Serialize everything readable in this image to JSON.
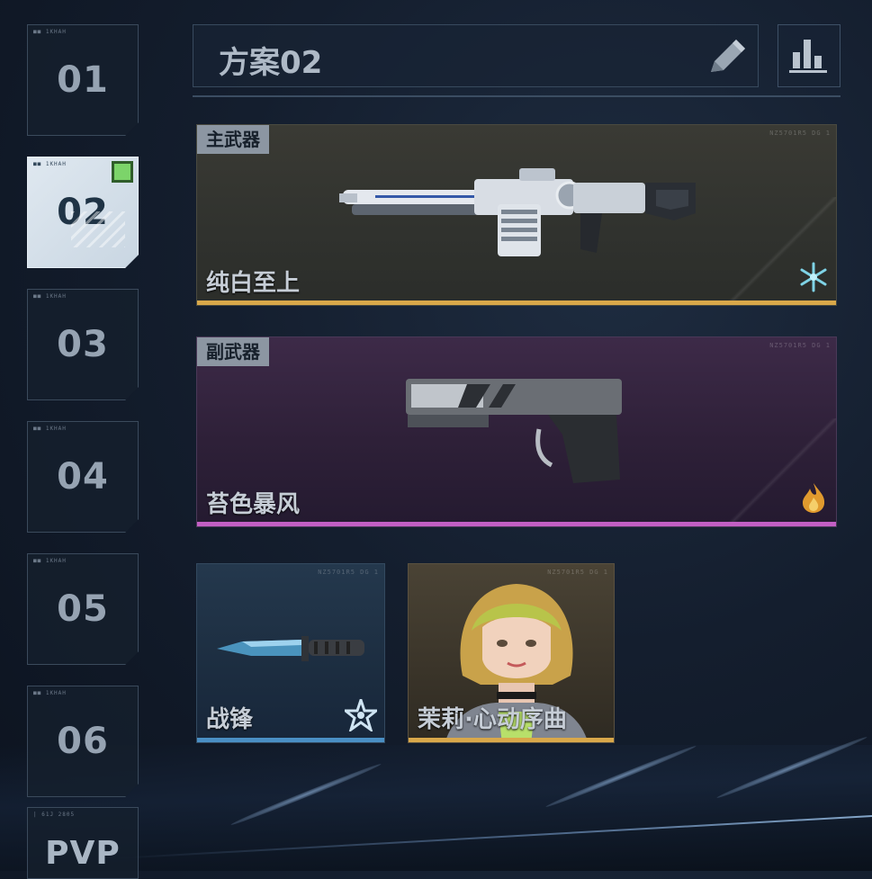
{
  "slots": [
    {
      "label": "01",
      "tag": "■■ 1KHAH"
    },
    {
      "label": "02",
      "tag": "■■ 1KHAH"
    },
    {
      "label": "03",
      "tag": "■■ 1KHAH"
    },
    {
      "label": "04",
      "tag": "■■ 1KHAH"
    },
    {
      "label": "05",
      "tag": "■■ 1KHAH"
    },
    {
      "label": "06",
      "tag": "■■ 1KHAH"
    },
    {
      "label": "PVP",
      "tag": "| 61J 2805"
    }
  ],
  "active_slot": "02",
  "loadout": {
    "name": "方案02"
  },
  "icons": {
    "edit": "pencil-icon",
    "stats": "bar-chart-icon",
    "primary_rarity": "snowflake-icon",
    "secondary_rarity": "flame-icon",
    "melee_rarity": "star-burst-icon"
  },
  "primary": {
    "tab": "主武器",
    "name": "纯白至上",
    "serial": "NZ5701R5 DG 1",
    "accent": "#d9a84a"
  },
  "secondary": {
    "tab": "副武器",
    "name": "苔色暴风",
    "serial": "NZ5701R5 DG 1",
    "accent": "#c25fc4"
  },
  "melee": {
    "name": "战锋",
    "serial": "NZ5701R5 DG 1",
    "accent": "#4a8fc4"
  },
  "character": {
    "name": "茉莉·心动序曲",
    "serial": "NZ5701R5 DG 1",
    "accent": "#d9a84a"
  }
}
